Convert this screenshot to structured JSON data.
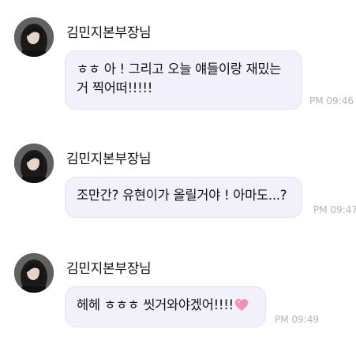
{
  "messages": [
    {
      "sender": "김민지본부장님",
      "lines": [
        "ㅎㅎ 아 ! 그리고 오늘 얘들이랑 재밌는",
        "거 찍어떠!!!!!"
      ],
      "time": "PM 09:46",
      "avatar_icon": "profile-photo"
    },
    {
      "sender": "김민지본부장님",
      "lines": [
        "조만간? 유현이가 올릴거야 ! 아마도...?"
      ],
      "time": "PM 09:47",
      "avatar_icon": "profile-photo"
    },
    {
      "sender": "김민지본부장님",
      "lines": [
        "헤헤 ㅎㅎㅎ 씻거와야겠어!!!!"
      ],
      "time": "PM 09:49",
      "avatar_icon": "profile-photo",
      "emoji": "pink-heart"
    }
  ],
  "colors": {
    "bubble_bg": "#f2f1fb",
    "bubble_border": "#e3e1f1",
    "time_text": "#b4b4b8",
    "heart": "#f48fb1"
  }
}
